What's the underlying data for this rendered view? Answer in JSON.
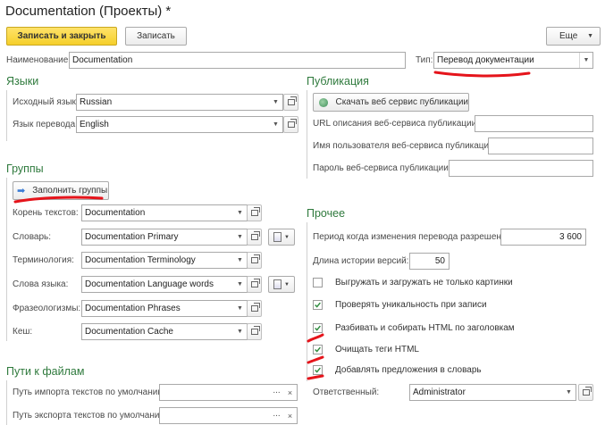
{
  "window": {
    "title": "Documentation (Проекты) *"
  },
  "toolbar": {
    "save_close_label": "Записать и закрыть",
    "save_label": "Записать",
    "more_label": "Еще"
  },
  "header": {
    "name_label": "Наименование:",
    "name_value": "Documentation",
    "type_label": "Тип:",
    "type_value": "Перевод документации"
  },
  "languages": {
    "title": "Языки",
    "source_label": "Исходный язык:",
    "source_value": "Russian",
    "target_label": "Язык перевода:",
    "target_value": "English"
  },
  "publication": {
    "title": "Публикация",
    "download_label": "Скачать веб сервис публикации",
    "url_label": "URL описания веб-сервиса публикации:",
    "url_value": "",
    "user_label": "Имя пользователя веб-сервиса публикации:",
    "user_value": "",
    "password_label": "Пароль веб-сервиса публикации:",
    "password_value": ""
  },
  "groups": {
    "title": "Группы",
    "fill_label": "Заполнить группы",
    "root_label": "Корень текстов:",
    "root_value": "Documentation",
    "dict_label": "Словарь:",
    "dict_value": "Documentation Primary",
    "term_label": "Терминология:",
    "term_value": "Documentation Terminology",
    "words_label": "Слова языка:",
    "words_value": "Documentation Language words",
    "phrases_label": "Фразеологизмы:",
    "phrases_value": "Documentation Phrases",
    "cache_label": "Кеш:",
    "cache_value": "Documentation Cache"
  },
  "other": {
    "title": "Прочее",
    "period_label": "Период когда изменения перевода разрешены:",
    "period_value": "3 600",
    "history_label": "Длина истории версий:",
    "history_value": "50",
    "cb_upload_label": "Выгружать и загружать не только картинки",
    "cb_upload_checked": false,
    "cb_unique_label": "Проверять уникальность при записи",
    "cb_unique_checked": true,
    "cb_split_label": "Разбивать и собирать HTML по заголовкам",
    "cb_split_checked": true,
    "cb_clean_label": "Очищать теги HTML",
    "cb_clean_checked": true,
    "cb_add_label": "Добавлять предложения в словарь",
    "cb_add_checked": true,
    "responsible_label": "Ответственный:",
    "responsible_value": "Administrator"
  },
  "paths": {
    "title": "Пути к файлам",
    "import_label": "Путь импорта текстов по умолчанию:",
    "import_value": "",
    "export_label": "Путь экспорта текстов по умолчанию:",
    "export_value": ""
  },
  "colors": {
    "section": "#2f7a3d",
    "primary_button": "#f5cf2a",
    "annotation": "#e5141b"
  }
}
